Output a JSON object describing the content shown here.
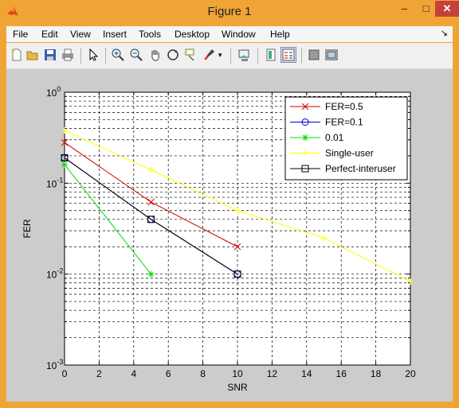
{
  "window": {
    "title": "Figure 1",
    "minimize": "–",
    "maximize": "□",
    "close": "✕"
  },
  "menu": [
    "File",
    "Edit",
    "View",
    "Insert",
    "Tools",
    "Desktop",
    "Window",
    "Help"
  ],
  "menu_arrow": "↘",
  "toolbar_icons": [
    "new-figure-icon",
    "open-file-icon",
    "save-icon",
    "print-icon",
    "edit-plot-arrow-icon",
    "zoom-in-icon",
    "zoom-out-icon",
    "pan-hand-icon",
    "rotate-3d-icon",
    "data-cursor-icon",
    "brush-icon",
    "brush-dropdown-icon",
    "link-plot-icon",
    "insert-colorbar-icon",
    "insert-legend-icon",
    "hide-plot-tools-icon",
    "show-plot-tools-icon"
  ],
  "chart_data": {
    "type": "line",
    "title": "",
    "xlabel": "SNR",
    "ylabel": "FER",
    "xlim": [
      0,
      20
    ],
    "ylim": [
      0.001,
      1
    ],
    "yscale": "log",
    "grid": true,
    "legend_position": "top-right",
    "x_ticks": [
      "0",
      "2",
      "4",
      "6",
      "8",
      "10",
      "12",
      "14",
      "16",
      "18",
      "20"
    ],
    "y_ticks": [
      {
        "base": "10",
        "exp": "0"
      },
      {
        "base": "10",
        "exp": "-1"
      },
      {
        "base": "10",
        "exp": "-2"
      },
      {
        "base": "10",
        "exp": "-3"
      }
    ],
    "series": [
      {
        "name": "FER=0.5",
        "color": "#cc0000",
        "marker": "x",
        "x": [
          0,
          5,
          10
        ],
        "y": [
          0.28,
          0.062,
          0.02
        ]
      },
      {
        "name": "FER=0.1",
        "color": "#0000cc",
        "marker": "o",
        "x": [
          0,
          5,
          10
        ],
        "y": [
          0.19,
          0.04,
          0.01
        ]
      },
      {
        "name": "0.01",
        "color": "#00dd00",
        "marker": "*",
        "x": [
          0,
          5
        ],
        "y": [
          0.16,
          0.01
        ]
      },
      {
        "name": "Single-user",
        "color": "#ffff00",
        "marker": "+",
        "x": [
          0,
          5,
          10,
          15,
          20
        ],
        "y": [
          0.38,
          0.14,
          0.05,
          0.025,
          0.0083
        ]
      },
      {
        "name": "Perfect-interuser",
        "color": "#000000",
        "marker": "s",
        "x": [
          0,
          5,
          10
        ],
        "y": [
          0.19,
          0.04,
          0.01
        ]
      }
    ]
  }
}
